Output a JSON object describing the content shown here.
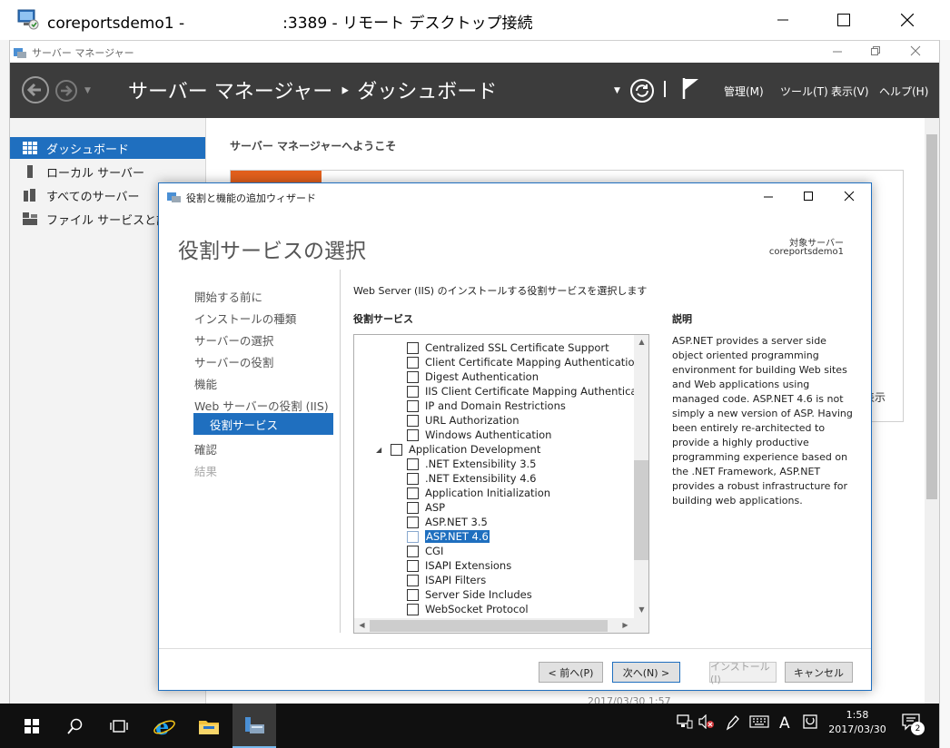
{
  "rdp_window": {
    "title": "coreportsdemo1 -                    :3389 - リモート デスクトップ接続"
  },
  "server_manager": {
    "title": "サーバー マネージャー",
    "breadcrumb": "サーバー マネージャー ‣ ダッシュボード",
    "menus": [
      "管理(M)",
      "ツール(T)",
      "表示(V)",
      "ヘルプ(H)"
    ],
    "nav": [
      {
        "label": "ダッシュボード",
        "active": true
      },
      {
        "label": "ローカル サーバー",
        "active": false
      },
      {
        "label": "すべてのサーバー",
        "active": false
      },
      {
        "label": "ファイル サービスと記憶",
        "active": false
      }
    ],
    "welcome": "サーバー マネージャーへようこそ",
    "tile_fragment": "表示",
    "bg_timestamp": "2017/03/30 1:57"
  },
  "wizard": {
    "title": "役割と機能の追加ウィザード",
    "heading": "役割サービスの選択",
    "target_label": "対象サーバー",
    "target_name": "coreportsdemo1",
    "steps": [
      {
        "label": "開始する前に",
        "state": "done"
      },
      {
        "label": "インストールの種類",
        "state": "done"
      },
      {
        "label": "サーバーの選択",
        "state": "done"
      },
      {
        "label": "サーバーの役割",
        "state": "done"
      },
      {
        "label": "機能",
        "state": "done"
      },
      {
        "label": "Web サーバーの役割 (IIS)",
        "state": "done"
      },
      {
        "label": "役割サービス",
        "state": "active"
      },
      {
        "label": "確認",
        "state": "done"
      },
      {
        "label": "結果",
        "state": "disabled"
      }
    ],
    "instruction": "Web Server (IIS) のインストールする役割サービスを選択します",
    "role_services_heading": "役割サービス",
    "description_heading": "説明",
    "description": "ASP.NET provides a server side\nobject oriented programming\nenvironment for building Web sites\nand Web applications using\nmanaged code. ASP.NET 4.6 is not\nsimply a new version of ASP. Having\nbeen entirely re-architected to\nprovide a highly productive\nprogramming experience based on\nthe .NET Framework, ASP.NET\nprovides a robust infrastructure for\nbuilding web applications.",
    "tree": [
      {
        "label": "Centralized SSL Certificate Support",
        "level": 2,
        "checked": false
      },
      {
        "label": "Client Certificate Mapping Authentication",
        "level": 2,
        "checked": false
      },
      {
        "label": "Digest Authentication",
        "level": 2,
        "checked": false
      },
      {
        "label": "IIS Client Certificate Mapping Authenticatio",
        "level": 2,
        "checked": false
      },
      {
        "label": "IP and Domain Restrictions",
        "level": 2,
        "checked": false
      },
      {
        "label": "URL Authorization",
        "level": 2,
        "checked": false
      },
      {
        "label": "Windows Authentication",
        "level": 2,
        "checked": false
      },
      {
        "label": "Application Development",
        "level": 1,
        "checked": false,
        "expanded": true
      },
      {
        "label": ".NET Extensibility 3.5",
        "level": 2,
        "checked": false
      },
      {
        "label": ".NET Extensibility 4.6",
        "level": 2,
        "checked": false
      },
      {
        "label": "Application Initialization",
        "level": 2,
        "checked": false
      },
      {
        "label": "ASP",
        "level": 2,
        "checked": false
      },
      {
        "label": "ASP.NET 3.5",
        "level": 2,
        "checked": false
      },
      {
        "label": "ASP.NET 4.6",
        "level": 2,
        "checked": false,
        "selected": true
      },
      {
        "label": "CGI",
        "level": 2,
        "checked": false
      },
      {
        "label": "ISAPI Extensions",
        "level": 2,
        "checked": false
      },
      {
        "label": "ISAPI Filters",
        "level": 2,
        "checked": false
      },
      {
        "label": "Server Side Includes",
        "level": 2,
        "checked": false
      },
      {
        "label": "WebSocket Protocol",
        "level": 2,
        "checked": false
      }
    ],
    "buttons": {
      "prev": "< 前へ(P)",
      "next": "次へ(N) >",
      "install": "インストール(I)",
      "cancel": "キャンセル"
    }
  },
  "taskbar": {
    "time": "1:58",
    "date": "2017/03/30",
    "ime": "A",
    "notifications": "2"
  },
  "colors": {
    "accent": "#1f6fbf",
    "sm_header": "#3c3c3c",
    "orange": "#e4601c",
    "taskbar": "#101010"
  }
}
